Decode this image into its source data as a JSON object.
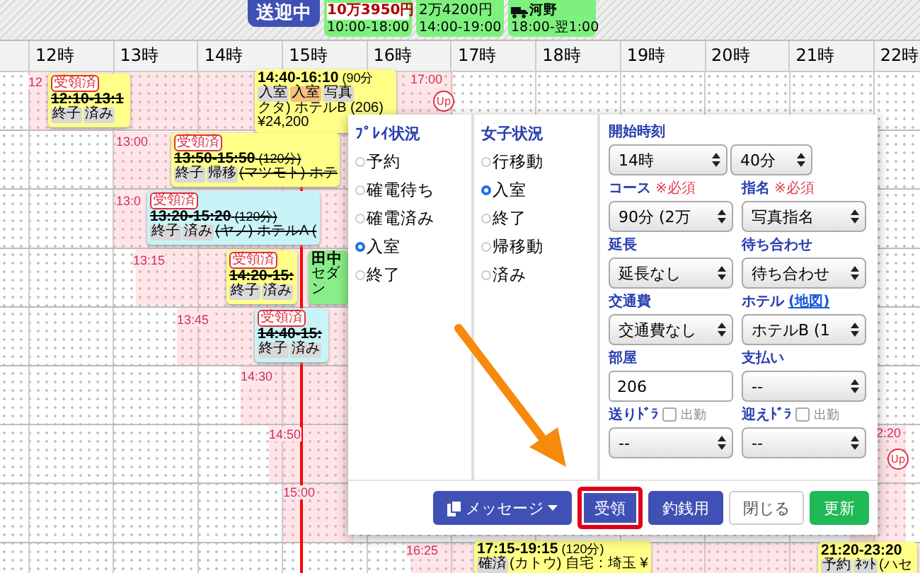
{
  "top_bar": {
    "status_badge": "送迎中",
    "drivers": [
      {
        "amount": "10万3950円",
        "alert": true,
        "hours": "10:00-18:00"
      },
      {
        "amount": "2万4200円",
        "alert": false,
        "hours": "14:00-19:00"
      },
      {
        "name": "河野",
        "hours": "18:00-翌1:00"
      }
    ]
  },
  "hours": [
    "12時",
    "13時",
    "14時",
    "15時",
    "16時",
    "17時",
    "18時",
    "19時",
    "20時",
    "21時",
    "22時"
  ],
  "time_marks": [
    "12",
    "17:00",
    "13:00",
    "13:0",
    "13:15",
    "13:45",
    "14:30",
    "14:50",
    "15:00",
    "16:25",
    "2:20"
  ],
  "up_badges": [
    "Up",
    "Up"
  ],
  "bookings": [
    {
      "badge": "受領済",
      "time": "12:10-13:1",
      "struck": true,
      "color": "#ffff88",
      "tags": [
        {
          "label": "終子",
          "color": "#d8d8d8"
        },
        {
          "label": "済み",
          "color": "#d8d8d8"
        }
      ]
    },
    {
      "time": "14:40-16:10",
      "duration": "(90分",
      "struck": false,
      "color": "#ffff88",
      "tags": [
        {
          "label": "入室",
          "color": "#d8d8d8"
        },
        {
          "label": "入室",
          "color": "#f5c080"
        },
        {
          "label": "写真",
          "color": "#d8d8d8"
        }
      ],
      "lines": [
        "クタ) ホテルB (206)",
        "¥24,200"
      ]
    },
    {
      "badge": "受領済",
      "time": "13:50-15:50",
      "duration": "(120分)",
      "struck": true,
      "color": "#ffff88",
      "tags": [
        {
          "label": "終子",
          "color": "#d8d8d8"
        },
        {
          "label": "帰移",
          "color": "#d8d8d8"
        }
      ],
      "detail": "(マツモト) ホテ"
    },
    {
      "badge": "受領済",
      "time": "13:20-15:20",
      "duration": "(120分)",
      "struck": true,
      "color": "#c8f4f8",
      "tags": [
        {
          "label": "終子",
          "color": "#d8d8d8"
        },
        {
          "label": "済み",
          "color": "#d8d8d8"
        }
      ],
      "detail": "(ヤノ) ホテルA ("
    },
    {
      "badge": "受領済",
      "time": "14:20-15:",
      "struck": true,
      "color": "#ffff88",
      "tags": [
        {
          "label": "終子",
          "color": "#d8d8d8"
        },
        {
          "label": "済み",
          "color": "#d8d8d8"
        }
      ]
    },
    {
      "time": "田中",
      "struck": false,
      "color": "#88ee88",
      "lines": [
        "セダン"
      ]
    },
    {
      "badge": "受領済",
      "time": "14:40-15:",
      "struck": true,
      "color": "#c8f4f8",
      "tags": [
        {
          "label": "終子",
          "color": "#d8d8d8"
        },
        {
          "label": "済み",
          "color": "#d8d8d8"
        }
      ]
    },
    {
      "time": "17:15-19:15",
      "duration": "(120分)",
      "struck": false,
      "color": "#ffff88",
      "tags": [
        {
          "label": "確済",
          "color": "#d8d8d8"
        }
      ],
      "detail": "(カトウ) 自宅：埼玉 ¥"
    },
    {
      "time": "21:20-23:20",
      "struck": false,
      "color": "#ffff88",
      "tags": [
        {
          "label": "予約",
          "color": "#d8d8d8"
        },
        {
          "label": "ﾈｯﾄ",
          "color": "#d8d8d8"
        }
      ],
      "detail": "(ハセ"
    }
  ],
  "popup": {
    "play_status": {
      "title": "ﾌﾟﾚｲ状況",
      "options": [
        {
          "label": "予約",
          "selected": false
        },
        {
          "label": "確電待ち",
          "selected": false
        },
        {
          "label": "確電済み",
          "selected": false
        },
        {
          "label": "入室",
          "selected": true
        },
        {
          "label": "終了",
          "selected": false
        }
      ]
    },
    "girl_status": {
      "title": "女子状況",
      "options": [
        {
          "label": "行移動",
          "selected": false
        },
        {
          "label": "入室",
          "selected": true
        },
        {
          "label": "終了",
          "selected": false
        },
        {
          "label": "帰移動",
          "selected": false
        },
        {
          "label": "済み",
          "selected": false
        }
      ]
    },
    "start_time": {
      "label": "開始時刻",
      "hour": "14時",
      "minute": "40分"
    },
    "fields": [
      {
        "label": "コース",
        "required": "※必須",
        "kind": "select",
        "value": "90分 (2万"
      },
      {
        "label": "指名",
        "required": "※必須",
        "kind": "select",
        "value": "写真指名"
      },
      {
        "label": "延長",
        "kind": "select",
        "value": "延長なし"
      },
      {
        "label": "待ち合わせ",
        "kind": "select",
        "value": "待ち合わせ"
      },
      {
        "label": "交通費",
        "kind": "select",
        "value": "交通費なし"
      },
      {
        "label": "ホテル",
        "link": "(地図)",
        "kind": "select",
        "value": "ホテルB (1"
      },
      {
        "label": "部屋",
        "kind": "input",
        "value": "206"
      },
      {
        "label": "支払い",
        "kind": "select",
        "value": "--"
      },
      {
        "label": "送りﾄﾞﾗ",
        "checkbox": {
          "label": "出勤",
          "checked": false
        },
        "kind": "select",
        "value": "--"
      },
      {
        "label": "迎えﾄﾞﾗ",
        "checkbox": {
          "label": "出勤",
          "checked": false
        },
        "kind": "select",
        "value": "--"
      }
    ],
    "buttons": [
      {
        "label": "メッセージ",
        "kind": "dropdown",
        "highlighted": false
      },
      {
        "label": "受領",
        "kind": "primary",
        "highlighted": true
      },
      {
        "label": "釣銭用",
        "kind": "primary",
        "highlighted": false
      },
      {
        "label": "閉じる",
        "kind": "default",
        "highlighted": false
      },
      {
        "label": "更新",
        "kind": "success",
        "highlighted": false
      }
    ]
  }
}
